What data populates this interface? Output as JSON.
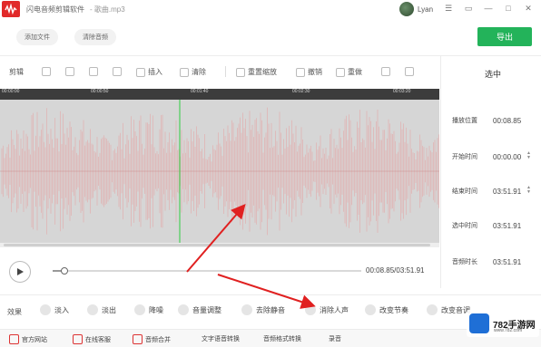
{
  "window": {
    "app_title": "闪电音频剪辑软件",
    "file_name": "- 歌曲.mp3",
    "username": "Lyan",
    "controls": [
      "minimize-icon",
      "maximize-icon",
      "close-icon",
      "menu-icon",
      "restore-icon"
    ]
  },
  "actions": {
    "add_file": "添加文件",
    "clear_audio": "清除音频",
    "export": "导出"
  },
  "toolbar": {
    "label": "剪辑",
    "insert": "插入",
    "clear": "清除",
    "reset_zoom": "重置缩放",
    "undo": "撤销",
    "redo": "重做"
  },
  "timeline": {
    "ticks": [
      "00:00:00",
      "00:00:50",
      "00:01:40",
      "00:02:30",
      "00:03:20"
    ]
  },
  "right_panel": {
    "title": "选中",
    "rows": [
      {
        "label": "播放位置",
        "value": "00:08.85"
      },
      {
        "label": "开始时间",
        "value": "00:00.00"
      },
      {
        "label": "结束时间",
        "value": "03:51.91"
      },
      {
        "label": "选中时间",
        "value": "03:51.91"
      },
      {
        "label": "音频时长",
        "value": "03:51.91"
      }
    ]
  },
  "player": {
    "time": "00:08.85/03:51.91",
    "progress": 0.038
  },
  "effects": {
    "label": "效果",
    "items": [
      "淡入",
      "淡出",
      "降噪",
      "音量调整",
      "去除静音",
      "消除人声",
      "改变节奏",
      "改变音调"
    ]
  },
  "bottom_bar": {
    "items": [
      "官方网站",
      "在线客服",
      "音频合并",
      "文字语音转换",
      "音频格式转换",
      "录音"
    ]
  },
  "watermark": {
    "text": "782手游网",
    "sub": "www.782.com"
  },
  "colors": {
    "accent_green": "#23b35a",
    "waveform": "#e0b4b4",
    "playhead": "#2ecc40",
    "brand_red": "#e12a2a",
    "arrow_red": "#e02020"
  }
}
